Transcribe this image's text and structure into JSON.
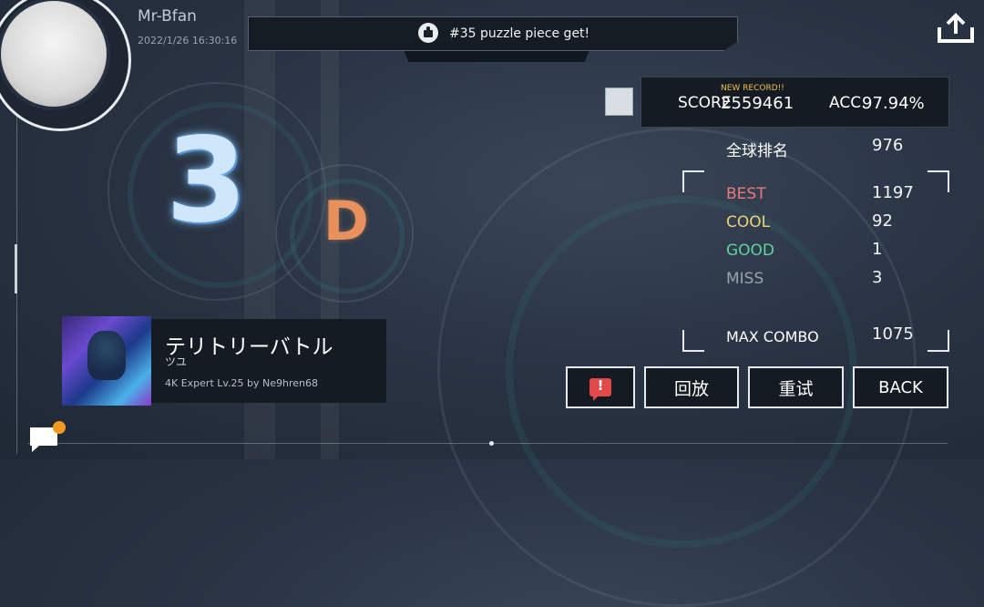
{
  "header": {
    "username": "Mr-Bfan",
    "datetime": "2022/1/26 16:30:16",
    "notification": "#35 puzzle piece get!",
    "share_icon": "share-icon"
  },
  "result": {
    "rank_number": "3",
    "grade": "D"
  },
  "song": {
    "title": "テリトリーバトル",
    "artist": "ツユ",
    "meta": "4K Expert  Lv.25 by Ne9hren68"
  },
  "score": {
    "new_record": "NEW RECORD!!",
    "score_label": "SCORE",
    "score_value": "2559461",
    "acc_label": "ACC.",
    "acc_value": "97.94%"
  },
  "stats": {
    "global_rank_label": "全球排名",
    "global_rank_value": "976",
    "best_label": "BEST",
    "best_value": "1197",
    "cool_label": "COOL",
    "cool_value": "92",
    "good_label": "GOOD",
    "good_value": "1",
    "miss_label": "MISS",
    "miss_value": "3",
    "max_combo_label": "MAX COMBO",
    "max_combo_value": "1075"
  },
  "buttons": {
    "report_icon": "alert-icon",
    "replay": "回放",
    "retry": "重试",
    "back": "BACK"
  },
  "colors": {
    "best": "#e8797d",
    "cool": "#e9d27a",
    "good": "#5fd3a2",
    "miss": "#9aa3ad",
    "grade": "#e8915d",
    "accent_badge": "#f29a1f",
    "report": "#e24a4a"
  }
}
